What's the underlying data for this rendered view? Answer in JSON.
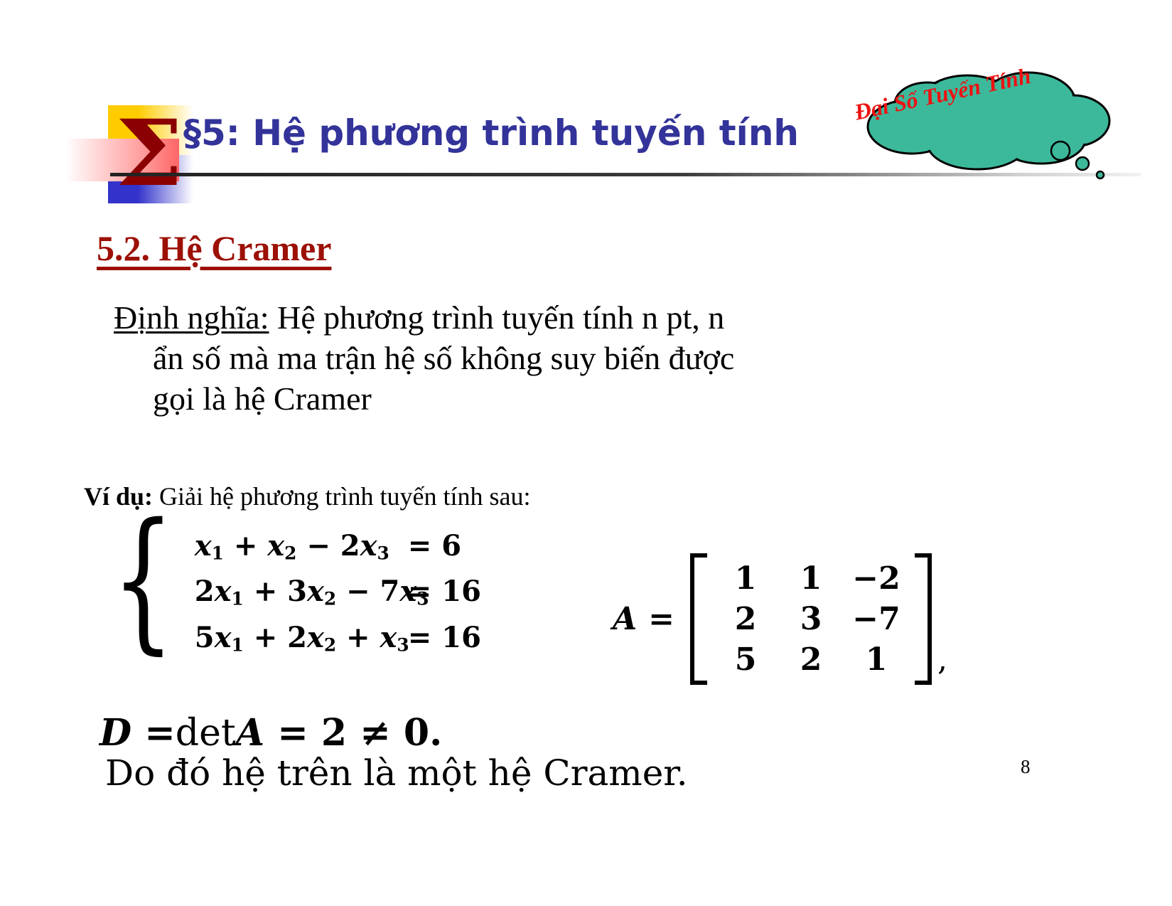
{
  "slide": {
    "title": "§5: Hệ phương trình tuyến tính",
    "page_number": "8",
    "title_color": "#33339A",
    "heading_color": "#9C1006",
    "cloud_fill": "#3CB99B",
    "cloud_text_color": "#EE1111",
    "logo": {
      "glyph": "Σ",
      "glyph_color": "#8B0000",
      "yellow": "#FFCC00",
      "blue": "#3333CC",
      "pink": "#FF6666"
    }
  },
  "cloud": {
    "label": "Đại Số Tuyến Tính"
  },
  "section": {
    "heading": "5.2. Hệ Cramer"
  },
  "definition": {
    "lead": "Định nghĩa:",
    "line1": " Hệ phương trình tuyến tính n pt, n",
    "line2": "ẩn số mà ma trận hệ số không suy biến được",
    "line3": "gọi là hệ Cramer"
  },
  "example": {
    "lead": "Ví dụ:",
    "text": " Giải hệ phương trình tuyến tính sau:",
    "system": [
      {
        "lhs_terms": [
          {
            "coef": "",
            "var": "x",
            "sub": "1",
            "op": ""
          },
          {
            "coef": "",
            "var": "x",
            "sub": "2",
            "op": "+"
          },
          {
            "coef": "2",
            "var": "x",
            "sub": "3",
            "op": "−"
          }
        ],
        "rhs": "= 6"
      },
      {
        "lhs_terms": [
          {
            "coef": "2",
            "var": "x",
            "sub": "1",
            "op": ""
          },
          {
            "coef": "3",
            "var": "x",
            "sub": "2",
            "op": "+"
          },
          {
            "coef": "7",
            "var": "x",
            "sub": "3",
            "op": "−"
          }
        ],
        "rhs": "= 16"
      },
      {
        "lhs_terms": [
          {
            "coef": "5",
            "var": "x",
            "sub": "1",
            "op": ""
          },
          {
            "coef": "2",
            "var": "x",
            "sub": "2",
            "op": "+"
          },
          {
            "coef": "",
            "var": "x",
            "sub": "3",
            "op": "+"
          }
        ],
        "rhs": "= 16"
      }
    ],
    "brace": "{",
    "matrix": {
      "name": "A",
      "equals": "=",
      "rows": [
        [
          "1",
          "1",
          "−2"
        ],
        [
          "2",
          "3",
          "−7"
        ],
        [
          "5",
          "2",
          "1"
        ]
      ],
      "trailing": ","
    },
    "determinant": {
      "symbol": "D",
      "equals1": "=",
      "det_word": "det",
      "matrix_name": "A",
      "equals2": "=",
      "value": "2",
      "neq": "≠",
      "zero": "0."
    },
    "conclusion": "Do đó hệ trên là một hệ Cramer."
  },
  "matrix_cells": {
    "r0c0": "1",
    "r0c1": "1",
    "r0c2": "−2",
    "r1c0": "2",
    "r1c1": "3",
    "r1c2": "−7",
    "r2c0": "5",
    "r2c1": "2",
    "r2c2": "1"
  },
  "equations_text": {
    "eq1_lhs": "x₁ + x₂ − 2x₃",
    "eq1_rhs": "= 6",
    "eq2_lhs": "2x₁ + 3x₂ − 7x₃",
    "eq2_rhs": "= 16",
    "eq3_lhs": "5x₁ + 2x₂ + x₃",
    "eq3_rhs": "= 16"
  }
}
